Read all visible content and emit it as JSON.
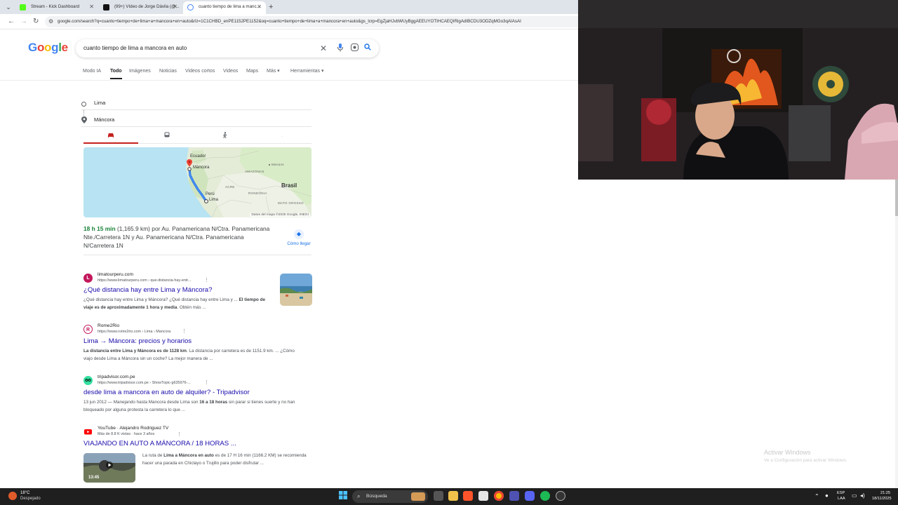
{
  "browser": {
    "tabs": [
      {
        "title": "Stream - Kick Dashboard",
        "active": false,
        "fav_color": "#53fc18"
      },
      {
        "title": "(99+) Vídeo de Jorge Dávila (@...",
        "active": false,
        "fav_color": "#111111"
      },
      {
        "title": "cuanto tiempo de lima a manc...",
        "active": true,
        "fav_color": "#4285f4"
      }
    ],
    "url": "google.com/search?q=cuanto+tiempo+de+lima+a+mancora+en+auto&rlz=1C1CHBD_enPE1152PE1152&oq=cuanto+tiempo+de+lima+a+mancora+en+auto&gs_lcrp=EgZjaHJvbWUyBggAEEUYOTIHCAEQIRigAdIBCDU3ODZqMGo3qAIAsAI"
  },
  "google": {
    "logo": [
      "G",
      "o",
      "o",
      "g",
      "l",
      "e"
    ],
    "query": "cuanto tiempo de lima a mancora en auto",
    "nav": [
      "Modo IA",
      "Todo",
      "Imágenes",
      "Noticias",
      "Videos cortos",
      "Videos",
      "Maps",
      "Más ▾",
      "Herramientas ▾"
    ],
    "directions": {
      "origin": "Lima",
      "destination": "Máncora",
      "modes": [
        "car-icon",
        "bus-icon",
        "walk-icon",
        "flight-icon"
      ],
      "map_labels": {
        "ecuador": "Ecuador",
        "mancora": "Máncora",
        "amazonas": "AMAZONAS",
        "manaos": "Manaos",
        "acre": "ACRE",
        "rondonia": "RONDÔNIA",
        "brasil": "Brasil",
        "peru": "Perú",
        "lima": "Lima",
        "mato": "MATO GROSSO",
        "credit": "Datos del mapa ©2025 Google, INEGI"
      },
      "time": "18 h 15 min",
      "summary": " (1,165.9 km) por Au. Panamericana N/Ctra. Panamericana Nte./Carretera 1N y Au. Panamericana N/Ctra. Panamericana N/Carretera 1N",
      "howto": "Cómo llegar"
    },
    "results": [
      {
        "site": "limatourperu.com",
        "cite": "https://www.limatourperu.com › que-distancia-hay-entr...",
        "title": "¿Qué distancia hay entre Lima y Máncora?",
        "snippet_a": "¿Qué distancia hay entre Lima y Máncora? ¿Qué distancia hay entre Lima y ... ",
        "snippet_b": "El tiempo de viaje es de aproximadamente 1 hora y media",
        "snippet_c": ". Obtén más ...",
        "fav_color": "#c2185b",
        "fav_letter": "L"
      },
      {
        "site": "Rome2Rio",
        "cite": "https://www.rome2rio.com › Lima › Mancora",
        "title": "Lima → Máncora: precios y horarios",
        "snippet_a": "",
        "snippet_b": "La distancia entre Lima y Máncora es de 1128 km",
        "snippet_c": ". La distancia por carretera es de 1151.9 km. ... ¿Cómo viajo desde Lima a Máncora sin un coche? La mejor manera de ...",
        "fav_color": "#c2185b",
        "fav_letter": "R"
      },
      {
        "site": "tripadvisor.com.pe",
        "cite": "https://www.tripadvisor.com.pe › ShowTopic-g635976-...",
        "title": "desde lima a mancora en auto de alquiler? - Tripadvisor",
        "snippet_a": "13 jun 2012 — Manejando hasta Mancora desde Lima son ",
        "snippet_b": "16 a 18 horas",
        "snippet_c": " sin parar si tienes suerte y no han bloqueado por alguna protesta la carretera lo que ...",
        "fav_color": "#34e0a1",
        "fav_letter": "T"
      },
      {
        "site": "YouTube · Alejandro Rodriguez TV",
        "cite": "Más de 8.8 K vistas · hace 3 años",
        "title": "VIAJANDO EN AUTO A MÁNCORA / 18 HORAS ...",
        "snippet_a": "La ruta de ",
        "snippet_b": "Lima a Máncora en auto",
        "snippet_c": " es de 17 H 16 min (1166.2 KM) se recomienda hacer una parada en Chiclayo o Trujillo para poder disfrutar ...",
        "fav_color": "#ff0000",
        "fav_letter": "▶",
        "duration": "13:45"
      }
    ]
  },
  "watermark": {
    "line1": "Activar Windows",
    "line2": "Ve a Configuración para activar Windows."
  },
  "taskbar": {
    "temp": "18°C",
    "condition": "Despejado",
    "search": "Búsqueda",
    "lang1": "ESP",
    "lang2": "LAA",
    "time": "21:25",
    "date": "18/11/2025"
  }
}
